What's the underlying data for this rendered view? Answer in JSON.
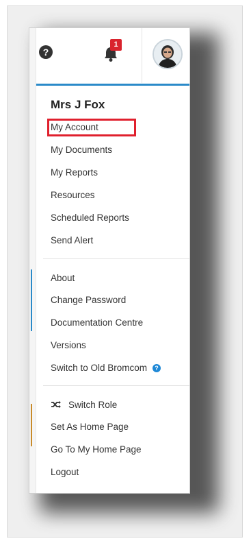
{
  "header": {
    "notification_count": "1",
    "icons": {
      "help": "help-icon",
      "bell": "bell-icon",
      "avatar": "avatar"
    }
  },
  "user": {
    "name": "Mrs J Fox"
  },
  "menu": {
    "group1": [
      {
        "label": "My Account"
      },
      {
        "label": "My Documents"
      },
      {
        "label": "My Reports"
      },
      {
        "label": "Resources"
      },
      {
        "label": "Scheduled Reports"
      },
      {
        "label": "Send Alert"
      }
    ],
    "group2": [
      {
        "label": "About"
      },
      {
        "label": "Change Password"
      },
      {
        "label": "Documentation Centre"
      },
      {
        "label": "Versions"
      },
      {
        "label": "Switch to Old Bromcom"
      }
    ],
    "group3": [
      {
        "label": "Switch Role"
      },
      {
        "label": "Set As Home Page"
      },
      {
        "label": "Go To My Home Page"
      },
      {
        "label": "Logout"
      }
    ]
  },
  "colors": {
    "header_border": "#2a8ac9",
    "badge": "#d9232d",
    "highlight": "#e0202d",
    "info_icon": "#1e88d6"
  }
}
